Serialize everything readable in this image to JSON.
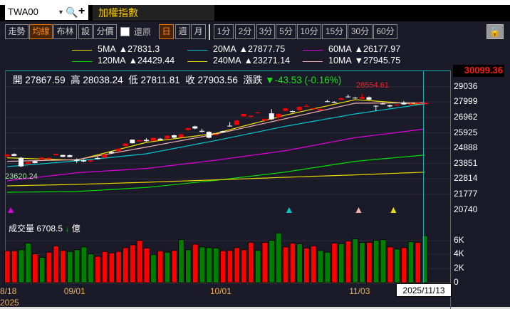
{
  "header": {
    "symbol": "TWA00",
    "title": "加權指數"
  },
  "toolbar": {
    "buttons": [
      {
        "label": "走勢",
        "active": false
      },
      {
        "label": "均線",
        "active": true
      },
      {
        "label": "布林",
        "active": false
      },
      {
        "label": "設",
        "active": false
      },
      {
        "label": "分價",
        "active": false
      }
    ],
    "restore_label": "還原",
    "restore_checked": false,
    "periods": [
      {
        "label": "日",
        "active": true
      },
      {
        "label": "週",
        "active": false
      },
      {
        "label": "月",
        "active": false
      }
    ],
    "minutes": [
      "1分",
      "2分",
      "3分",
      "5分",
      "10分",
      "15分",
      "30分",
      "60分"
    ],
    "lock_icon": "unlocked-padlock"
  },
  "legend": [
    {
      "name": "5MA",
      "arrow": "▲",
      "value": "27831.3",
      "color": "#f0e000"
    },
    {
      "name": "20MA",
      "arrow": "▲",
      "value": "27877.75",
      "color": "#00c8d0"
    },
    {
      "name": "60MA",
      "arrow": "▲",
      "value": "26177.97",
      "color": "#e000e0"
    },
    {
      "name": "120MA",
      "arrow": "▲",
      "value": "24429.44",
      "color": "#00e000"
    },
    {
      "name": "240MA",
      "arrow": "▲",
      "value": "23271.14",
      "color": "#e8d800"
    },
    {
      "name": "10MA",
      "arrow": "▼",
      "value": "27945.75",
      "color": "#f0b0b0"
    }
  ],
  "info": {
    "open_label": "開",
    "open": "27867.59",
    "high_label": "高",
    "high": "28038.24",
    "low_label": "低",
    "low": "27811.81",
    "close_label": "收",
    "close": "27903.56",
    "change_label": "漲跌",
    "change": "▼-43.53 (-0.16%)"
  },
  "volume": {
    "label": "成交量",
    "value": "6708.5",
    "arrow": "↓",
    "unit": "億"
  },
  "tooltip_date": "2025/11/13",
  "chart_data": {
    "type": "candlestick",
    "price_axis": {
      "max_label": "30099.36",
      "ticks": [
        "29036",
        "27999",
        "26962",
        "25925",
        "24888",
        "23851",
        "22814",
        "21777",
        "20740"
      ]
    },
    "volume_axis": {
      "ticks": [
        "6K",
        "4K",
        "2K",
        "0"
      ],
      "range": [
        0,
        6000
      ]
    },
    "x_labels": [
      {
        "label": "8/18",
        "index": 0
      },
      {
        "label": "09/01",
        "index": 10
      },
      {
        "label": "10/01",
        "index": 31
      },
      {
        "label": "11/03",
        "index": 51
      }
    ],
    "year_label": "2025",
    "high_label": "28554.61",
    "low_label": "23620.24",
    "colors": {
      "up": "#ff0000",
      "down": "#ffffff",
      "vol_up": "#ff0000",
      "vol_down": "#008000"
    },
    "ohlc": [
      [
        24338,
        24480,
        24300,
        24458
      ],
      [
        24490,
        24540,
        24350,
        24370
      ],
      [
        24238,
        24300,
        23620.24,
        23660
      ],
      [
        23826,
        23960,
        23800,
        23946
      ],
      [
        24010,
        24060,
        23860,
        23890
      ],
      [
        24130,
        24280,
        24100,
        24250
      ],
      [
        24150,
        24260,
        24120,
        24230
      ],
      [
        24422,
        24520,
        24400,
        24502
      ],
      [
        24426,
        24450,
        24280,
        24306
      ],
      [
        24410,
        24460,
        24280,
        24290
      ],
      [
        24118,
        24200,
        23900,
        24038
      ],
      [
        24070,
        24140,
        23950,
        23990
      ],
      [
        23990,
        24100,
        23920,
        24070
      ],
      [
        24230,
        24330,
        24120,
        24150
      ],
      [
        24250,
        24460,
        24220,
        24450
      ],
      [
        24630,
        24700,
        24530,
        24550
      ],
      [
        24686,
        24880,
        24660,
        24846
      ],
      [
        25038,
        25240,
        25010,
        25198
      ],
      [
        25462,
        25480,
        25200,
        25222
      ],
      [
        25350,
        25450,
        25330,
        25430
      ],
      [
        25446,
        25560,
        25320,
        25366
      ],
      [
        25386,
        25600,
        25360,
        25586
      ],
      [
        25526,
        25580,
        25430,
        25446
      ],
      [
        25530,
        25740,
        25500,
        25730
      ],
      [
        25758,
        25800,
        25560,
        25598
      ],
      [
        25626,
        25840,
        25600,
        25826
      ],
      [
        26114,
        26280,
        26080,
        26234
      ],
      [
        26356,
        26400,
        26160,
        26216
      ],
      [
        26060,
        26200,
        25950,
        26000
      ],
      [
        25990,
        26030,
        25550,
        25590
      ],
      [
        25760,
        25850,
        25740,
        25820
      ],
      [
        26038,
        26070,
        25930,
        25958
      ],
      [
        26402,
        26640,
        26340,
        26362
      ],
      [
        26466,
        26780,
        26440,
        26746
      ],
      [
        27038,
        27230,
        27010,
        27198
      ],
      [
        27008,
        27100,
        26920,
        27068
      ],
      [
        27258,
        27360,
        27220,
        27298
      ],
      [
        26738,
        26860,
        26440,
        26858
      ],
      [
        27238,
        27520,
        26780,
        26838
      ],
      [
        26966,
        27230,
        26700,
        27206
      ],
      [
        27406,
        27600,
        27380,
        27566
      ],
      [
        27388,
        27420,
        27300,
        27328
      ],
      [
        27456,
        27700,
        27430,
        27676
      ],
      [
        27690,
        27870,
        27670,
        27730
      ],
      [
        27530,
        27620,
        27450,
        27570
      ],
      [
        27436,
        27550,
        27410,
        27536
      ],
      [
        28050,
        28150,
        27990,
        28010
      ],
      [
        28012,
        28060,
        27930,
        27952
      ],
      [
        28156,
        28280,
        28140,
        28256
      ],
      [
        28370,
        28500,
        28290,
        28330
      ],
      [
        28290,
        28360,
        28220,
        28250
      ],
      [
        28226,
        28554.61,
        28200,
        28346
      ],
      [
        28318,
        28380,
        28140,
        28158
      ],
      [
        27746,
        27780,
        27400,
        27706
      ],
      [
        27890,
        27980,
        27840,
        27850
      ],
      [
        27782,
        27820,
        27620,
        27702
      ],
      [
        27760,
        27850,
        27740,
        27820
      ],
      [
        27962,
        28060,
        27820,
        27842
      ],
      [
        27824,
        27940,
        27800,
        27884
      ],
      [
        27880,
        27990,
        27860,
        27947.09
      ],
      [
        27867.59,
        28038.24,
        27811.81,
        27903.56
      ]
    ],
    "volume_values": [
      4550,
      4550,
      4700,
      5650,
      4100,
      3600,
      4350,
      5250,
      4600,
      4450,
      4700,
      5100,
      4100,
      3750,
      4450,
      4250,
      4450,
      5000,
      5400,
      6050,
      4950,
      4000,
      4550,
      4350,
      4600,
      6150,
      4700,
      5500,
      5100,
      5000,
      4950,
      4550,
      4600,
      5000,
      4700,
      5750,
      4600,
      5750,
      6050,
      7100,
      5100,
      5650,
      5550,
      4950,
      5250,
      4600,
      4350,
      5650,
      5550,
      5950,
      6250,
      5750,
      5750,
      6050,
      6150,
      5100,
      4800,
      5000,
      5850,
      5750,
      6708.5
    ],
    "volume_up": [
      1,
      1,
      0,
      0,
      1,
      0,
      1,
      1,
      1,
      0,
      0,
      0,
      0,
      1,
      1,
      1,
      1,
      1,
      1,
      1,
      1,
      0,
      1,
      0,
      1,
      0,
      0,
      1,
      0,
      0,
      0,
      1,
      1,
      1,
      1,
      1,
      0,
      1,
      0,
      0,
      1,
      1,
      0,
      1,
      1,
      0,
      0,
      1,
      0,
      1,
      0,
      0,
      1,
      0,
      0,
      1,
      0,
      1,
      0,
      1,
      0
    ],
    "moving_averages": [
      {
        "name": "5MA",
        "color": "#f0e000",
        "index": [
          0,
          10,
          20,
          30,
          40,
          50,
          60
        ],
        "values": [
          24238,
          24078,
          25278,
          25886,
          27118,
          28158,
          27831.3
        ]
      },
      {
        "name": "10MA",
        "color": "#f0b0b0",
        "index": [
          0,
          10,
          20,
          30,
          40,
          50,
          60
        ],
        "values": [
          23998,
          24110,
          24958,
          25838,
          26878,
          27918,
          27945.75
        ]
      },
      {
        "name": "20MA",
        "color": "#00c8d0",
        "index": [
          0,
          10,
          20,
          30,
          40,
          50,
          60
        ],
        "values": [
          23646,
          24030,
          24510,
          25406,
          26366,
          27198,
          27877.75
        ]
      },
      {
        "name": "60MA",
        "color": "#e000e0",
        "index": [
          0,
          10,
          20,
          30,
          40,
          50,
          60
        ],
        "values": [
          22686,
          23230,
          23518,
          24078,
          24718,
          25598,
          26177.97
        ]
      },
      {
        "name": "120MA",
        "color": "#00e000",
        "index": [
          0,
          10,
          20,
          30,
          40,
          50,
          60
        ],
        "values": [
          21918,
          21966,
          22238,
          22718,
          23278,
          23998,
          24429.44
        ]
      },
      {
        "name": "240MA",
        "color": "#e8d800",
        "index": [
          0,
          10,
          20,
          30,
          40,
          50,
          60
        ],
        "values": [
          22350,
          22446,
          22590,
          22750,
          22926,
          23086,
          23271.14
        ]
      }
    ],
    "signal_markers": [
      {
        "index": 0,
        "color": "#e000e0"
      },
      {
        "index": 40,
        "color": "#00c8d0"
      },
      {
        "index": 50,
        "color": "#f0b0b0"
      },
      {
        "index": 55,
        "color": "#f0e000"
      }
    ]
  }
}
